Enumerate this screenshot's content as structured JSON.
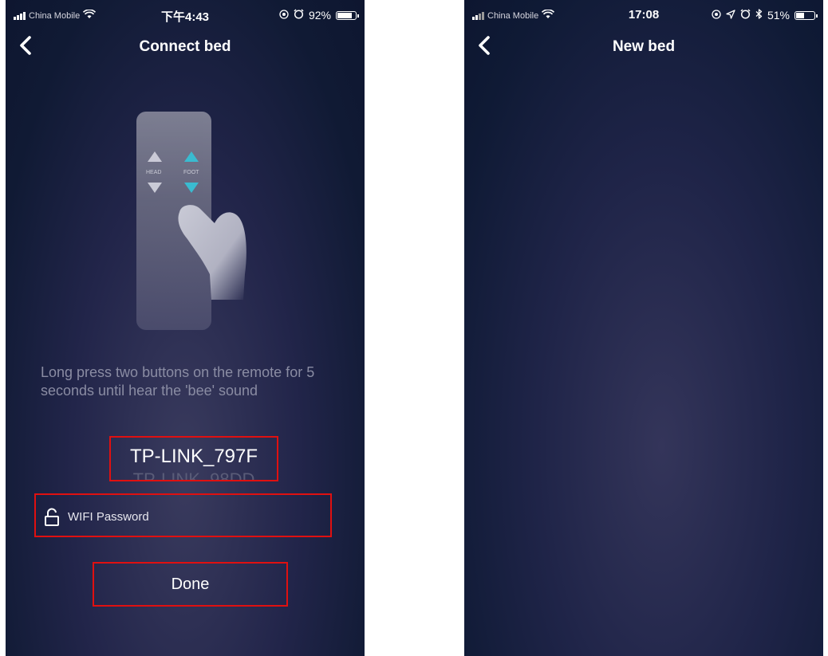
{
  "left_screen": {
    "status": {
      "carrier": "China Mobile",
      "time": "下午4:43",
      "battery": "92%",
      "battery_level": 0.92
    },
    "title": "Connect bed",
    "remote": {
      "head_label": "HEAD",
      "foot_label": "FOOT"
    },
    "instruction": "Long press two buttons on the remote for 5 seconds until hear the 'bee' sound",
    "ssid": "TP-LINK_797F",
    "ssid_next": "TP-LINK_98DD",
    "password_placeholder": "WIFI Password",
    "done_label": "Done"
  },
  "right_screen": {
    "status": {
      "carrier": "China Mobile",
      "time": "17:08",
      "battery": "51%",
      "battery_level": 0.51
    },
    "title": "New bed"
  },
  "colors": {
    "highlight": "#e01010",
    "accent_cyan": "#3fd6e8"
  },
  "icons": {
    "back": "chevron-left-icon",
    "lock": "unlock-icon",
    "wifi": "wifi-icon",
    "alarm": "alarm-icon",
    "location": "location-icon",
    "bluetooth": "bluetooth-icon"
  }
}
